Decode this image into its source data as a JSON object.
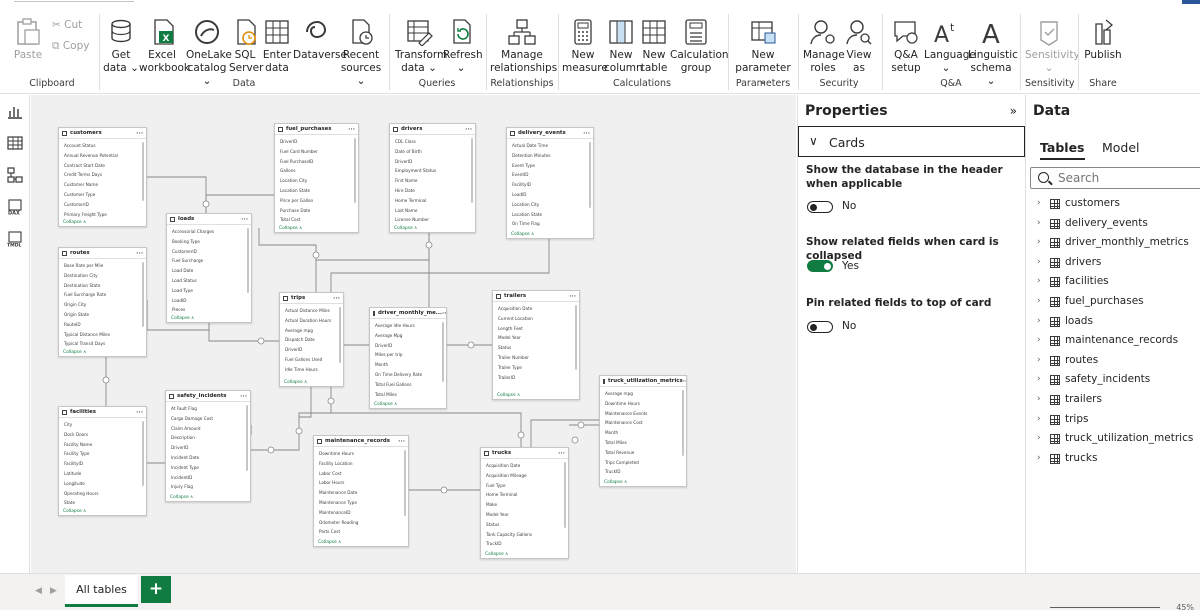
{
  "ribbon": {
    "clipboard": {
      "paste": "Paste",
      "cut": "Cut",
      "copy": "Copy",
      "group": "Clipboard"
    },
    "data": {
      "get_data": "Get data ⌄",
      "excel": "Excel workbook",
      "onelake": "OneLake catalog ⌄",
      "sql": "SQL Server",
      "enter": "Enter data",
      "dataverse": "Dataverse",
      "recent": "Recent sources ⌄",
      "group": "Data"
    },
    "queries": {
      "transform": "Transform data ⌄",
      "refresh": "Refresh ⌄",
      "group": "Queries"
    },
    "relationships": {
      "manage": "Manage relationships",
      "group": "Relationships"
    },
    "calculations": {
      "new_measure": "New measure",
      "new_column": "New column",
      "new_table": "New table",
      "calc_group": "Calculation group",
      "group": "Calculations"
    },
    "parameters": {
      "new_parameter": "New parameter ⌄",
      "group": "Parameters"
    },
    "security": {
      "manage_roles": "Manage roles",
      "view_as": "View as",
      "group": "Security"
    },
    "qa": {
      "qa_setup": "Q&A setup",
      "language": "Language ⌄",
      "linguistic": "Linguistic schema ⌄",
      "group": "Q&A"
    },
    "sensitivity": {
      "label": "Sensitivity ⌄",
      "group": "Sensitivity"
    },
    "share": {
      "publish": "Publish",
      "group": "Share"
    }
  },
  "canvas": {
    "tables": [
      {
        "id": "customers",
        "title": "customers",
        "fields": [
          "Account Status",
          "Annual Revenue Potential",
          "Contract Start Date",
          "Credit Terms Days",
          "Customer Name",
          "Customer Type",
          "CustomerID",
          "Primary Freight Type"
        ],
        "collapse": "Collapse ∧"
      },
      {
        "id": "fuel_purchases",
        "title": "fuel_purchases",
        "fields": [
          "DriverID",
          "Fuel Card Number",
          "Fuel PurchaseID",
          "Gallons",
          "Location City",
          "Location State",
          "Price per Gallon",
          "Purchase Date",
          "Total Cost"
        ],
        "collapse": "Collapse ∧"
      },
      {
        "id": "drivers",
        "title": "drivers",
        "fields": [
          "CDL Class",
          "Date of Birth",
          "DriverID",
          "Employment Status",
          "First Name",
          "Hire Date",
          "Home Terminal",
          "Last Name",
          "License Number"
        ],
        "collapse": "Collapse ∧"
      },
      {
        "id": "delivery_events",
        "title": "delivery_events",
        "fields": [
          "Actual Date Time",
          "Detention Minutes",
          "Event Type",
          "EventID",
          "FacilityID",
          "LoadID",
          "Location City",
          "Location State",
          "On Time Flag"
        ],
        "collapse": "Collapse ∧"
      },
      {
        "id": "loads",
        "title": "loads",
        "fields": [
          "Accessorial Charges",
          "Booking Type",
          "CustomerID",
          "Fuel Surcharge",
          "Load Date",
          "Load Status",
          "Load Type",
          "LoadID",
          "Pieces"
        ],
        "collapse": "Collapse ∧"
      },
      {
        "id": "routes",
        "title": "routes",
        "fields": [
          "Base Rate per Mile",
          "Destination City",
          "Destination State",
          "Fuel Surcharge Rate",
          "Origin City",
          "Origin State",
          "RouteID",
          "Typical Distance Miles",
          "Typical Transit Days"
        ],
        "collapse": "Collapse ∧"
      },
      {
        "id": "trips",
        "title": "trips",
        "fields": [
          "Actual Distance Miles",
          "Actual Duration Hours",
          "Average mpg",
          "Dispatch Date",
          "DriverID",
          "Fuel Gallons Used",
          "Idle Time Hours"
        ],
        "collapse": "Collapse ∧"
      },
      {
        "id": "driver_monthly_metrics",
        "title": "driver_monthly_me...",
        "fields": [
          "Average Idle Hours",
          "Average Mpg",
          "DriverID",
          "Miles per trip",
          "Month",
          "On Time Delivery Rate",
          "Total Fuel Gallons",
          "Total Miles"
        ],
        "collapse": "Collapse ∧"
      },
      {
        "id": "trailers",
        "title": "trailers",
        "fields": [
          "Acquisition Date",
          "Current Location",
          "Length Feet",
          "Model Year",
          "Status",
          "Trailer Number",
          "Trailer Type",
          "TrailerID"
        ],
        "collapse": "Collapse ∧"
      },
      {
        "id": "truck_utilization_metrics",
        "title": "truck_utilization_metrics",
        "fields": [
          "Average mpg",
          "Downtime Hours",
          "Maintenance Events",
          "Maintenance Cost",
          "Month",
          "Total Miles",
          "Total Revenue",
          "Trips Completed",
          "TruckID"
        ],
        "collapse": "Collapse ∧"
      },
      {
        "id": "facilities",
        "title": "facilities",
        "fields": [
          "City",
          "Dock Doors",
          "Facility Name",
          "Facility Type",
          "FacilityID",
          "Latitude",
          "Longitude",
          "Operating Hours",
          "State"
        ],
        "collapse": "Collapse ∧"
      },
      {
        "id": "safety_incidents",
        "title": "safety_incidents",
        "fields": [
          "At Fault Flag",
          "Cargo Damage Cost",
          "Claim Amount",
          "Description",
          "DriverID",
          "Incident Date",
          "Incident Type",
          "IncidentID",
          "Injury Flag"
        ],
        "collapse": "Collapse ∧"
      },
      {
        "id": "maintenance_records",
        "title": "maintenance_records",
        "fields": [
          "Downtime Hours",
          "Facility Location",
          "Labor Cost",
          "Labor Hours",
          "Maintenance Date",
          "Maintenance Type",
          "MaintenanceID",
          "Odometer Reading",
          "Parts Cost"
        ],
        "collapse": "Collapse ∧"
      },
      {
        "id": "trucks",
        "title": "trucks",
        "fields": [
          "Acquisition Date",
          "Acquisition Mileage",
          "Fuel Type",
          "Home Terminal",
          "Make",
          "Model Year",
          "Status",
          "Tank Capacity Gallons",
          "TruckID"
        ],
        "collapse": "Collapse ∧"
      }
    ]
  },
  "bottom": {
    "tab_label": "All tables",
    "add_label": "+",
    "zoom": "45%"
  },
  "properties": {
    "title": "Properties",
    "collapse_glyph": "»",
    "section": "Cards",
    "section_glyph": "∨",
    "options": [
      {
        "label": "Show the database in the header when applicable",
        "value": "No",
        "on": false
      },
      {
        "label": "Show related fields when card is collapsed",
        "value": "Yes",
        "on": true
      },
      {
        "label": "Pin related fields to top of card",
        "value": "No",
        "on": false
      }
    ]
  },
  "data_pane": {
    "title": "Data",
    "tab_tables": "Tables",
    "tab_model": "Model",
    "search_placeholder": "Search",
    "tables": [
      "customers",
      "delivery_events",
      "driver_monthly_metrics",
      "drivers",
      "facilities",
      "fuel_purchases",
      "loads",
      "maintenance_records",
      "routes",
      "safety_incidents",
      "trailers",
      "trips",
      "truck_utilization_metrics",
      "trucks"
    ]
  },
  "colors": {
    "accent": "#107c41",
    "canvas_bg": "#f0f0f0",
    "border": "#e1dfdd"
  },
  "icons": [
    "paste-icon",
    "cut-icon",
    "copy-icon",
    "get-data-icon",
    "excel-icon",
    "onelake-icon",
    "sql-server-icon",
    "enter-data-icon",
    "dataverse-icon",
    "recent-sources-icon",
    "transform-data-icon",
    "refresh-icon",
    "manage-relationships-icon",
    "calculator-icon",
    "new-column-icon",
    "new-table-icon",
    "calculation-group-icon",
    "new-parameter-icon",
    "manage-roles-icon",
    "view-as-icon",
    "qa-setup-icon",
    "language-icon",
    "linguistic-schema-icon",
    "sensitivity-icon",
    "publish-icon",
    "report-view-icon",
    "table-view-icon",
    "model-view-icon",
    "dax-query-icon",
    "tmdl-icon",
    "search-icon",
    "chevron-right-icon",
    "table-icon"
  ]
}
